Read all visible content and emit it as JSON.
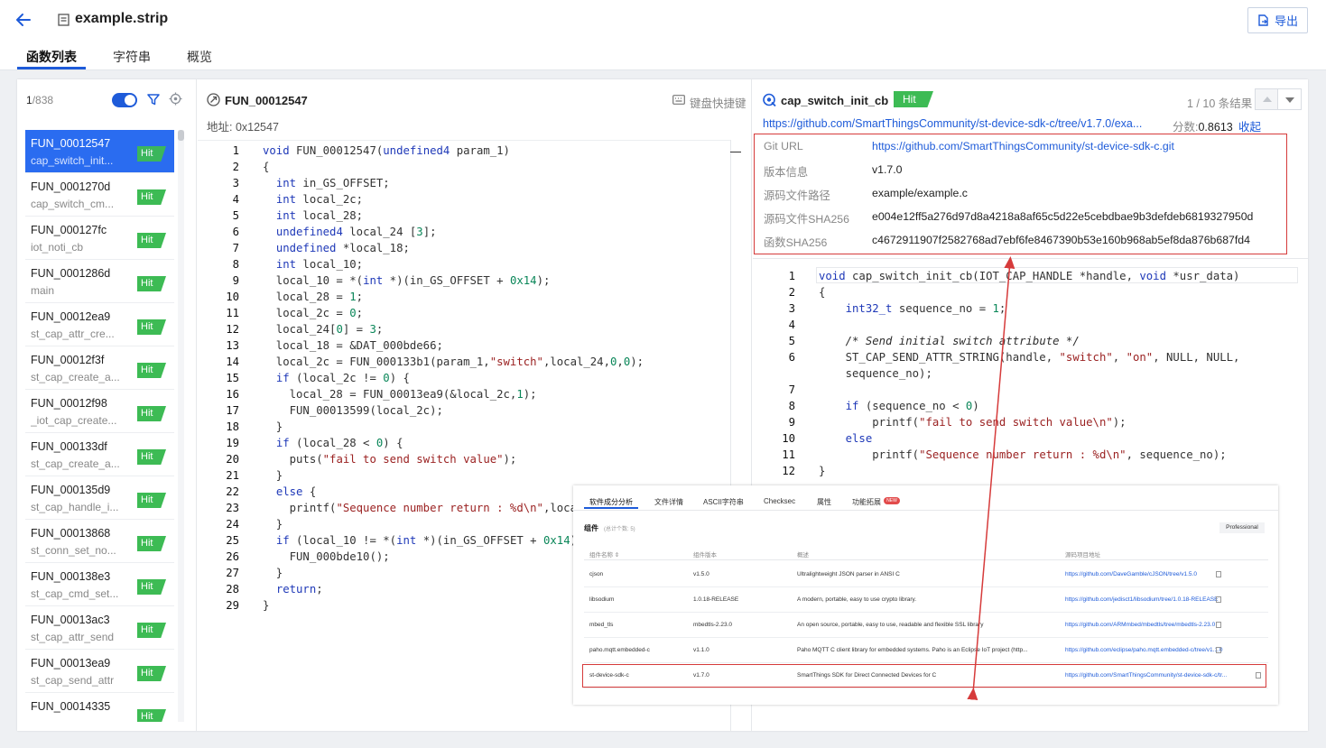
{
  "header": {
    "file_title": "example.strip",
    "export_label": "导出"
  },
  "tabs": [
    {
      "label": "函数列表",
      "active": true
    },
    {
      "label": "字符串",
      "active": false
    },
    {
      "label": "概览",
      "active": false
    }
  ],
  "function_list": {
    "current": "1",
    "total": "/838",
    "items": [
      {
        "name": "FUN_00012547",
        "sub": "cap_switch_init...",
        "badge": "Hit",
        "selected": true
      },
      {
        "name": "FUN_0001270d",
        "sub": "cap_switch_cm...",
        "badge": "Hit"
      },
      {
        "name": "FUN_000127fc",
        "sub": "iot_noti_cb",
        "badge": "Hit"
      },
      {
        "name": "FUN_0001286d",
        "sub": "main",
        "badge": "Hit"
      },
      {
        "name": "FUN_00012ea9",
        "sub": "st_cap_attr_cre...",
        "badge": "Hit"
      },
      {
        "name": "FUN_00012f3f",
        "sub": "st_cap_create_a...",
        "badge": "Hit"
      },
      {
        "name": "FUN_00012f98",
        "sub": "_iot_cap_create...",
        "badge": "Hit"
      },
      {
        "name": "FUN_000133df",
        "sub": "st_cap_create_a...",
        "badge": "Hit"
      },
      {
        "name": "FUN_000135d9",
        "sub": "st_cap_handle_i...",
        "badge": "Hit"
      },
      {
        "name": "FUN_00013868",
        "sub": "st_conn_set_no...",
        "badge": "Hit"
      },
      {
        "name": "FUN_000138e3",
        "sub": "st_cap_cmd_set...",
        "badge": "Hit"
      },
      {
        "name": "FUN_00013ac3",
        "sub": "st_cap_attr_send",
        "badge": "Hit"
      },
      {
        "name": "FUN_00013ea9",
        "sub": "st_cap_send_attr",
        "badge": "Hit"
      },
      {
        "name": "FUN_00014335",
        "sub": "",
        "badge": "Hit"
      }
    ]
  },
  "decompiled": {
    "title": "FUN_00012547",
    "address": "地址: 0x12547",
    "keyboard_label": "键盘快捷键",
    "lines": [
      "void FUN_00012547(undefined4 param_1)",
      "{",
      "  int in_GS_OFFSET;",
      "  int local_2c;",
      "  int local_28;",
      "  undefined4 local_24 [3];",
      "  undefined *local_18;",
      "  int local_10;",
      "  local_10 = *(int *)(in_GS_OFFSET + 0x14);",
      "  local_28 = 1;",
      "  local_2c = 0;",
      "  local_24[0] = 3;",
      "  local_18 = &DAT_000bde66;",
      "  local_2c = FUN_000133b1(param_1,\"switch\",local_24,0,0);",
      "  if (local_2c != 0) {",
      "    local_28 = FUN_00013ea9(&local_2c,1);",
      "    FUN_00013599(local_2c);",
      "  }",
      "  if (local_28 < 0) {",
      "    puts(\"fail to send switch value\");",
      "  }",
      "  else {",
      "    printf(\"Sequence number return : %d\\n\",local_28);",
      "  }",
      "  if (local_10 != *(int *)(in_GS_OFFSET + 0x14)) {",
      "    FUN_000bde10();",
      "  }",
      "  return;",
      "}"
    ]
  },
  "match": {
    "title": "cap_switch_init_cb",
    "badge": "Hit",
    "result_count": "1 / 10 条结果",
    "url": "https://github.com/SmartThingsCommunity/st-device-sdk-c/tree/v1.7.0/exa...",
    "score_label": "分数:",
    "score_value": "0.8613",
    "collapse_label": "收起",
    "info": [
      {
        "key": "Git URL",
        "value": "https://github.com/SmartThingsCommunity/st-device-sdk-c.git",
        "link": true
      },
      {
        "key": "版本信息",
        "value": "v1.7.0"
      },
      {
        "key": "源码文件路径",
        "value": "example/example.c"
      },
      {
        "key": "源码文件SHA256",
        "value": "e004e12ff5a276d97d8a4218a8af65c5d22e5cebdbae9b3defdeb6819327950d"
      },
      {
        "key": "函数SHA256",
        "value": "c4672911907f2582768ad7ebf6fe8467390b53e160b968ab5ef8da876b687fd4"
      }
    ],
    "source_lines": [
      {
        "n": "1",
        "t": "void cap_switch_init_cb(IOT_CAP_HANDLE *handle, void *usr_data)"
      },
      {
        "n": "2",
        "t": "{"
      },
      {
        "n": "3",
        "t": "    int32_t sequence_no = 1;"
      },
      {
        "n": "4",
        "t": ""
      },
      {
        "n": "5",
        "t": "    /* Send initial switch attribute */"
      },
      {
        "n": "6",
        "t": "    ST_CAP_SEND_ATTR_STRING(handle, \"switch\", \"on\", NULL, NULL,"
      },
      {
        "n": "",
        "t": "    sequence_no);"
      },
      {
        "n": "7",
        "t": ""
      },
      {
        "n": "8",
        "t": "    if (sequence_no < 0)"
      },
      {
        "n": "9",
        "t": "        printf(\"fail to send switch value\\n\");"
      },
      {
        "n": "10",
        "t": "    else"
      },
      {
        "n": "11",
        "t": "        printf(\"Sequence number return : %d\\n\", sequence_no);"
      },
      {
        "n": "12",
        "t": "}"
      }
    ]
  },
  "overlay": {
    "tabs": [
      "软件成分分析",
      "文件详情",
      "ASCII字符串",
      "Checksec",
      "属性",
      "功能拓展"
    ],
    "new_badge": "NEW",
    "section_title": "组件",
    "section_total": "(总计个数: 5)",
    "professional": "Professional",
    "headers": [
      "组件名称 ⇕",
      "组件版本",
      "概述",
      "源码项目地址"
    ],
    "rows": [
      {
        "name": "cjson",
        "version": "v1.5.0",
        "desc": "Ultralightweight JSON parser in ANSI C",
        "url": "https://github.com/DaveGamble/cJSON/tree/v1.5.0"
      },
      {
        "name": "libsodium",
        "version": "1.0.18-RELEASE",
        "desc": "A modern, portable, easy to use crypto library.",
        "url": "https://github.com/jedisct1/libsodium/tree/1.0.18-RELEASE"
      },
      {
        "name": "mbed_tls",
        "version": "mbedtls-2.23.0",
        "desc": "An open source, portable, easy to use, readable and flexible SSL library",
        "url": "https://github.com/ARMmbed/mbedtls/tree/mbedtls-2.23.0"
      },
      {
        "name": "paho.mqtt.embedded-c",
        "version": "v1.1.0",
        "desc": "Paho MQTT C client library for embedded systems. Paho is an Eclipse IoT project (http...",
        "url": "https://github.com/eclipse/paho.mqtt.embedded-c/tree/v1.1.0"
      },
      {
        "name": "st-device-sdk-c",
        "version": "v1.7.0",
        "desc": "SmartThings SDK for Direct Connected Devices for C",
        "url": "https://github.com/SmartThingsCommunity/st-device-sdk-c/tr..."
      }
    ]
  },
  "colors": {
    "accent": "#1e5bd9",
    "hit": "#3dbb54",
    "highlight": "#d63b3b"
  }
}
